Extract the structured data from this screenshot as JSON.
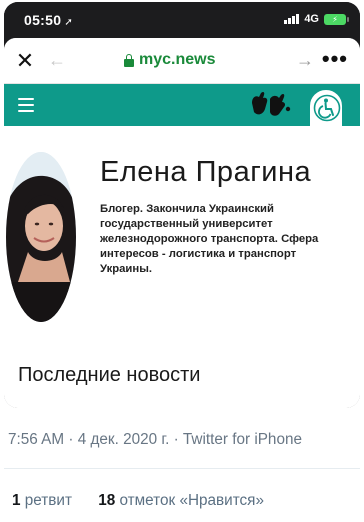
{
  "status_bar": {
    "time": "05:50",
    "network": "4G",
    "battery": "⚡"
  },
  "browser": {
    "url": "myc.news"
  },
  "site_header": {
    "accent_color": "#0e9a8a"
  },
  "author": {
    "name": "Елена Прагина",
    "bio": "Блогер. Закончила Украинский государственный университет железнодорожного транспорта. Сфера интересов - логистика и транспорт Украины."
  },
  "section": {
    "latest_news": "Последние новости"
  },
  "tweet": {
    "meta": "7:56 AM · 4 дек. 2020 г. · Twitter for iPhone",
    "retweets_count": "1",
    "retweets_label": "ретвит",
    "likes_count": "18",
    "likes_label": "отметок «Нравится»"
  }
}
